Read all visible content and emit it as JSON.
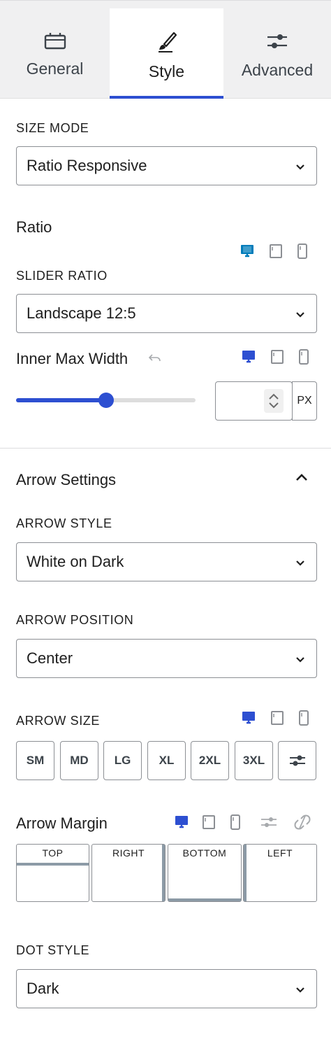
{
  "tabs": [
    {
      "label": "General",
      "icon": "briefcase-icon",
      "active": false
    },
    {
      "label": "Style",
      "icon": "brush-icon",
      "active": true
    },
    {
      "label": "Advanced",
      "icon": "sliders-icon",
      "active": false
    }
  ],
  "size_mode": {
    "label": "SIZE MODE",
    "value": "Ratio Responsive"
  },
  "ratio": {
    "heading": "Ratio"
  },
  "slider_ratio": {
    "label": "SLIDER RATIO",
    "value": "Landscape 12:5"
  },
  "inner_max_width": {
    "label": "Inner Max Width",
    "fraction": 0.5,
    "unit": "PX",
    "value": ""
  },
  "arrow_settings": {
    "heading": "Arrow Settings"
  },
  "arrow_style": {
    "label": "ARROW STYLE",
    "value": "White on Dark"
  },
  "arrow_position": {
    "label": "ARROW POSITION",
    "value": "Center"
  },
  "arrow_size": {
    "label": "ARROW SIZE",
    "options": [
      "SM",
      "MD",
      "LG",
      "XL",
      "2XL",
      "3XL"
    ]
  },
  "arrow_margin": {
    "label": "Arrow Margin",
    "sides": [
      "TOP",
      "RIGHT",
      "BOTTOM",
      "LEFT"
    ]
  },
  "dot_style": {
    "label": "DOT STYLE",
    "value": "Dark"
  },
  "colors": {
    "accent": "#2d4fd1",
    "device_active": "#007cba",
    "border": "#8c8f94"
  }
}
